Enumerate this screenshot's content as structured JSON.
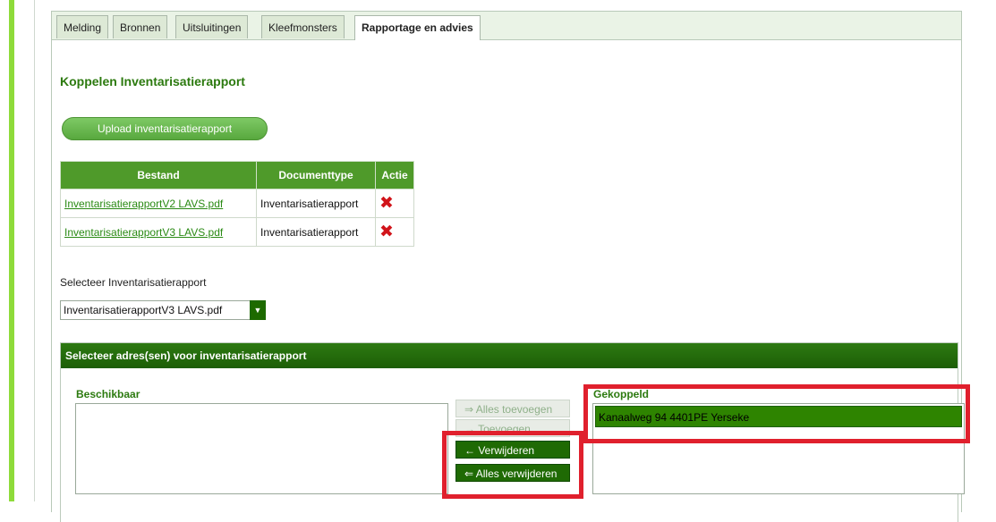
{
  "tabs": [
    {
      "label": "Melding"
    },
    {
      "label": "Bronnen"
    },
    {
      "label": "Uitsluitingen"
    },
    {
      "label": "Kleefmonsters"
    },
    {
      "label": "Rapportage en advies"
    }
  ],
  "section_title": "Koppelen Inventarisatierapport",
  "upload_button": "Upload inventarisatierapport",
  "table": {
    "headers": [
      "Bestand",
      "Documenttype",
      "Actie"
    ],
    "rows": [
      {
        "file": "InventarisatierapportV2 LAVS.pdf",
        "type": "Inventarisatierapport",
        "action_icon": "delete-x-icon"
      },
      {
        "file": "InventarisatierapportV3 LAVS.pdf",
        "type": "Inventarisatierapport",
        "action_icon": "delete-x-icon"
      }
    ]
  },
  "select_label": "Selecteer Inventarisatierapport",
  "select_value": "InventarisatierapportV3 LAVS.pdf",
  "group": {
    "title": "Selecteer adres(sen) voor inventarisatierapport",
    "available_label": "Beschikbaar",
    "linked_label": "Gekoppeld",
    "linked_items": [
      "Kanaalweg 94 4401PE Yerseke"
    ],
    "buttons": {
      "add_all": "⇒ Alles toevoegen",
      "add": "→ Toevoegen",
      "remove": "← Verwijderen",
      "remove_all": "⇐ Alles verwijderen"
    }
  },
  "colors": {
    "accent": "#8edb3a",
    "header_green": "#1c5e06",
    "highlight_red": "#e0202d",
    "delete_red": "#d1141a"
  }
}
